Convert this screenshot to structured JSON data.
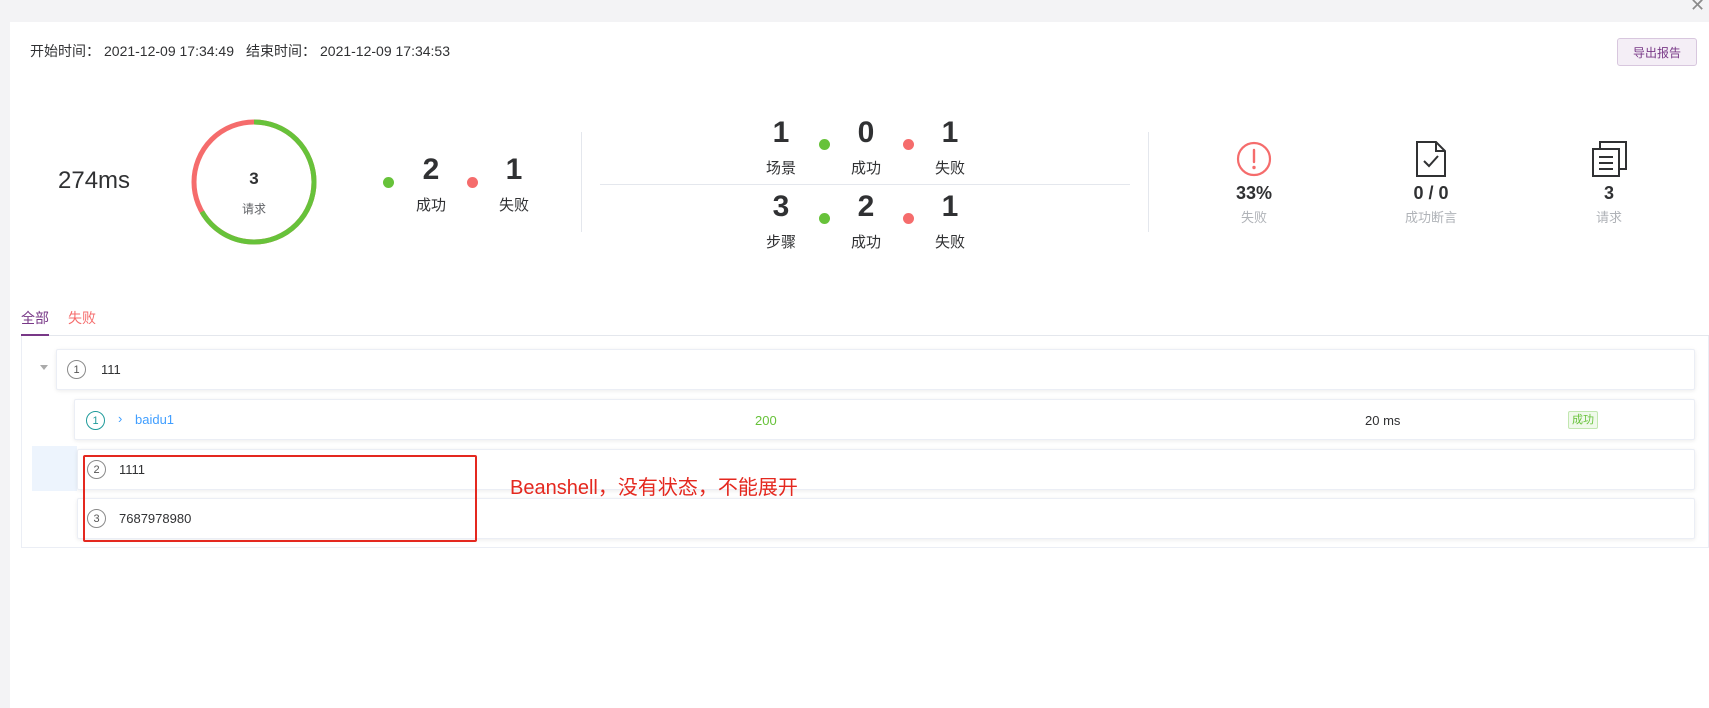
{
  "header": {
    "start_label": "开始时间：",
    "start_time": "2021-12-09 17:34:49",
    "end_label": "结束时间：",
    "end_time": "2021-12-09 17:34:53",
    "export_label": "导出报告"
  },
  "summary": {
    "duration": "274ms",
    "ring_count": "3",
    "ring_label": "请求",
    "request_success": "2",
    "request_success_label": "成功",
    "request_fail": "1",
    "request_fail_label": "失败",
    "ring_success_fraction": 0.667,
    "colors": {
      "success": "#67c23a",
      "fail": "#f56c6c",
      "brand": "#783887"
    }
  },
  "scenario_stats": {
    "scene_count": "1",
    "scene_label": "场景",
    "scene_success": "0",
    "scene_success_label": "成功",
    "scene_fail": "1",
    "scene_fail_label": "失败",
    "step_count": "3",
    "step_label": "步骤",
    "step_success": "2",
    "step_success_label": "成功",
    "step_fail": "1",
    "step_fail_label": "失败"
  },
  "metrics": [
    {
      "icon": "alert-circle-icon",
      "value": "33%",
      "label": "失败"
    },
    {
      "icon": "document-check-icon",
      "value": "0 / 0",
      "label": "成功断言"
    },
    {
      "icon": "copy-list-icon",
      "value": "3",
      "label": "请求"
    }
  ],
  "tabs": {
    "all": "全部",
    "fail": "失败"
  },
  "tree": {
    "scenario": {
      "index": "1",
      "name": "111"
    },
    "steps": [
      {
        "index": "1",
        "name": "baidu1",
        "status_code": "200",
        "time": "20 ms",
        "result": "成功"
      },
      {
        "index": "2",
        "name": "1111"
      },
      {
        "index": "3",
        "name": "7687978980"
      }
    ]
  },
  "annotation": "Beanshell，没有状态，不能展开"
}
